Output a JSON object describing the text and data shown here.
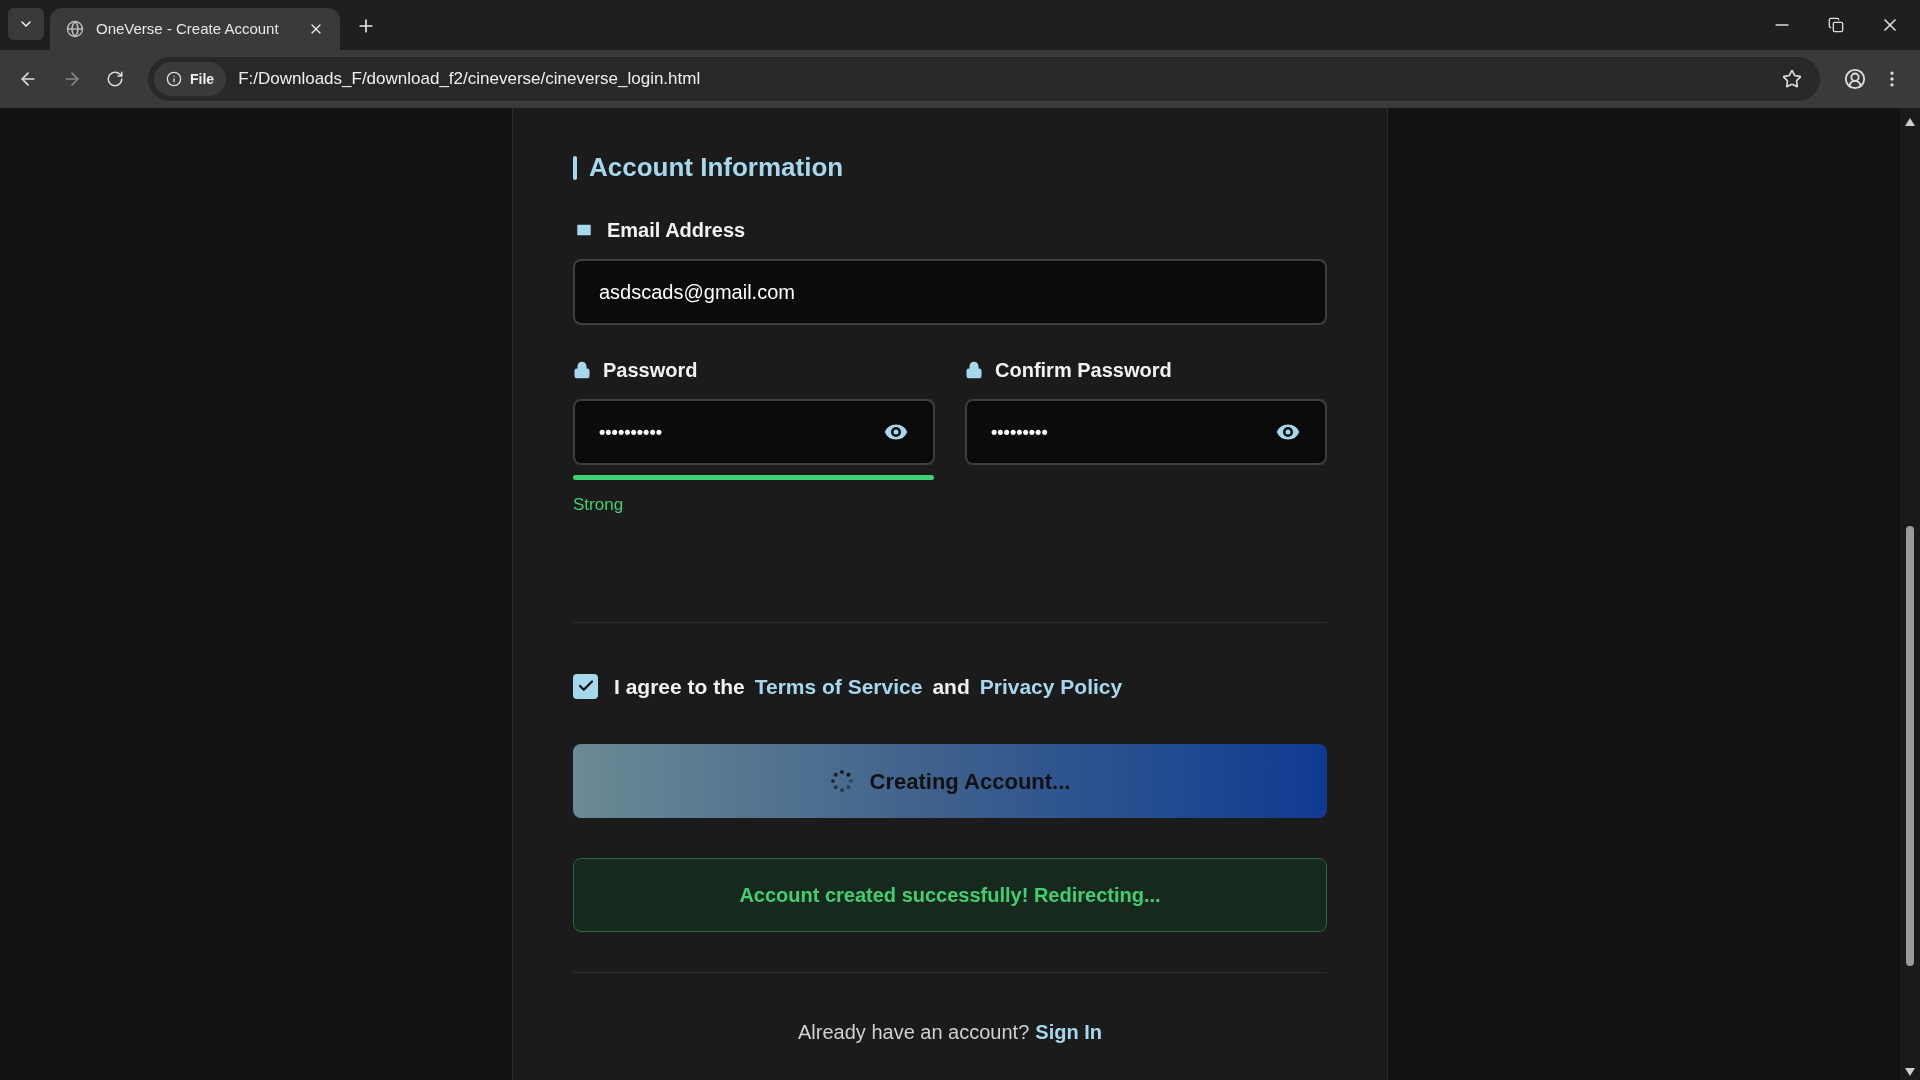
{
  "browser": {
    "tab": {
      "title": "OneVerse - Create Account",
      "selected": true
    },
    "address": {
      "badge": "File",
      "url": "F:/Downloads_F/download_f2/cineverse/cineverse_login.html"
    }
  },
  "form": {
    "section_title": "Account Information",
    "email": {
      "label": "Email Address",
      "value": "asdscads@gmail.com"
    },
    "password": {
      "label": "Password",
      "value": "••••••••••"
    },
    "confirm_password": {
      "label": "Confirm Password",
      "value": "•••••••••"
    },
    "strength": {
      "level": 1,
      "label": "Strong"
    },
    "agree": {
      "checked": true,
      "prefix": "I agree to the",
      "terms_link": "Terms of Service",
      "joiner": "and",
      "privacy_link": "Privacy Policy"
    },
    "submit": {
      "label": "Creating Account...",
      "loading": true
    },
    "success_message": "Account created successfully! Redirecting...",
    "signin": {
      "prompt": "Already have an account?",
      "link": "Sign In"
    }
  }
}
